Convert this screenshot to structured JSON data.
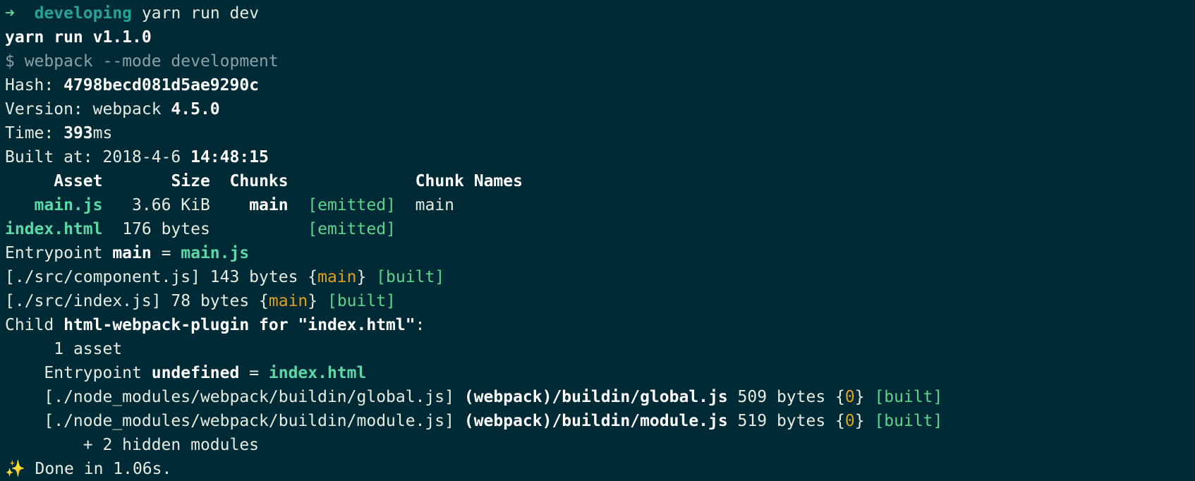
{
  "terminal": {
    "prompt": {
      "arrow": "➜",
      "directory": "developing",
      "command": "yarn run dev"
    },
    "yarn_version": "yarn run v1.1.0",
    "script_cmd": "$ webpack --mode development",
    "hash_label": "Hash: ",
    "hash_value": "4798becd081d5ae9290c",
    "version_label": "Version: webpack ",
    "version_value": "4.5.0",
    "time_label": "Time: ",
    "time_value": "393",
    "time_unit": "ms",
    "built_label": "Built at: 2018-4-6 ",
    "built_time": "14:48:15",
    "table": {
      "headers": [
        "Asset",
        "Size",
        "Chunks",
        "Chunk Names"
      ],
      "rows": [
        {
          "asset": "main.js",
          "size": "3.66 KiB",
          "chunks": "main",
          "status": "[emitted]",
          "chunk_names": "main"
        },
        {
          "asset": "index.html",
          "size": "176 bytes",
          "chunks": "",
          "status": "[emitted]",
          "chunk_names": ""
        }
      ]
    },
    "entrypoint": {
      "label": "Entrypoint ",
      "name": "main",
      "eq": " = ",
      "file": "main.js"
    },
    "modules": [
      {
        "path": "[./src/component.js] 143 bytes {",
        "chunk": "main",
        "close": "} ",
        "status": "[built]"
      },
      {
        "path": "[./src/index.js] 78 bytes {",
        "chunk": "main",
        "close": "} ",
        "status": "[built]"
      }
    ],
    "child": {
      "prefix": "Child ",
      "name": "html-webpack-plugin for \"index.html\"",
      "suffix": ":",
      "asset_count": "1 asset",
      "entry_label": "Entrypoint ",
      "entry_name": "undefined",
      "entry_eq": " = ",
      "entry_file": "index.html",
      "modules": [
        {
          "path": "[./node_modules/webpack/buildin/global.js] ",
          "name": "(webpack)/buildin/global.js",
          "size": " 509 bytes {",
          "chunk": "0",
          "close": "} ",
          "status": "[built]"
        },
        {
          "path": "[./node_modules/webpack/buildin/module.js] ",
          "name": "(webpack)/buildin/module.js",
          "size": " 519 bytes {",
          "chunk": "0",
          "close": "} ",
          "status": "[built]"
        }
      ],
      "hidden": "+ 2 hidden modules"
    },
    "done_icon": "✨",
    "done_text": " Done in 1.06s."
  }
}
